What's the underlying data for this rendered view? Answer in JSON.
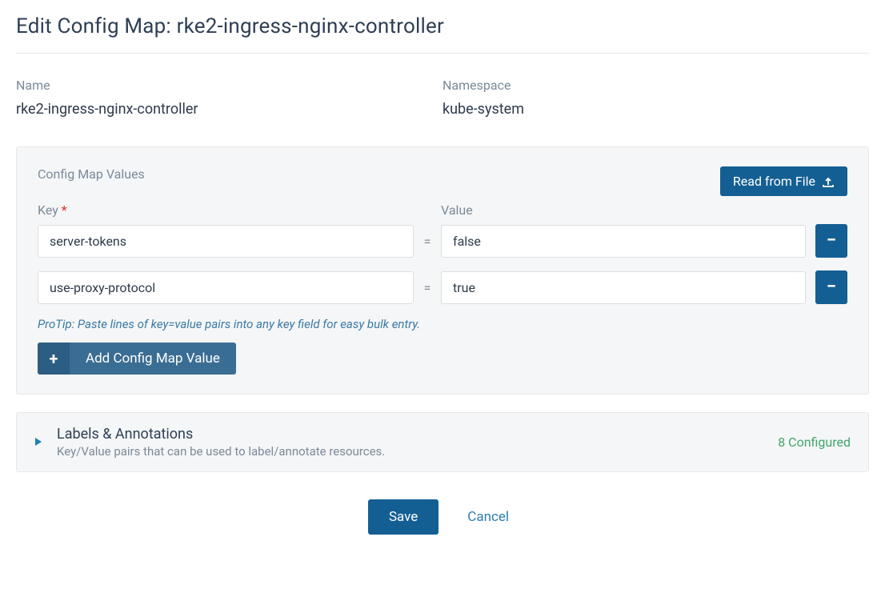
{
  "page": {
    "title": "Edit Config Map: rke2-ingress-nginx-controller"
  },
  "meta": {
    "name_label": "Name",
    "name_value": "rke2-ingress-nginx-controller",
    "namespace_label": "Namespace",
    "namespace_value": "kube-system"
  },
  "configmap": {
    "section_title": "Config Map Values",
    "read_file_label": "Read from File",
    "key_label": "Key",
    "value_label": "Value",
    "required_mark": "*",
    "eq": "=",
    "rows": [
      {
        "key": "server-tokens",
        "value": "false"
      },
      {
        "key": "use-proxy-protocol",
        "value": "true"
      }
    ],
    "protip": "ProTip: Paste lines of key=value pairs into any key field for easy bulk entry.",
    "add_label": "Add Config Map Value",
    "remove_symbol": "−",
    "plus_symbol": "+"
  },
  "labels_section": {
    "title": "Labels & Annotations",
    "subtitle": "Key/Value pairs that can be used to label/annotate resources.",
    "badge": "8 Configured"
  },
  "footer": {
    "save": "Save",
    "cancel": "Cancel"
  }
}
